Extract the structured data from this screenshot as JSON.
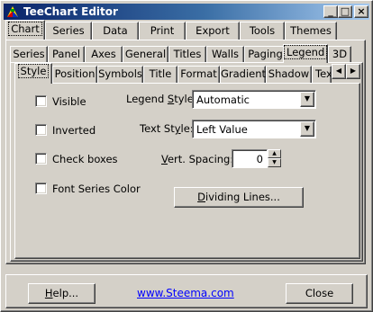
{
  "window": {
    "title": "TeeChart Editor",
    "controls": {
      "minimize": "_",
      "maximize": "□",
      "close": "×"
    }
  },
  "tabs_row1": [
    "Chart",
    "Series",
    "Data",
    "Print",
    "Export",
    "Tools",
    "Themes"
  ],
  "tabs_row1_selected": "Chart",
  "tabs_row2": [
    "Series",
    "Panel",
    "Axes",
    "General",
    "Titles",
    "Walls",
    "Paging",
    "Legend",
    "3D"
  ],
  "tabs_row2_selected": "Legend",
  "tabs_row3": [
    "Style",
    "Position",
    "Symbols",
    "Title",
    "Format",
    "Gradient",
    "Shadow",
    "Tex"
  ],
  "tabs_row3_selected": "Style",
  "tab_scroll": {
    "left": "◀",
    "right": "▶"
  },
  "legend_style_tab": {
    "checkboxes": [
      {
        "label": "Visible",
        "checked": false
      },
      {
        "label": "Inverted",
        "checked": false
      },
      {
        "label": "Check boxes",
        "checked": false
      },
      {
        "label": "Font Series Color",
        "checked": false
      }
    ],
    "legend_style": {
      "label_pre": "Legend ",
      "label_u": "S",
      "label_post": "tyle:",
      "value": "Automatic"
    },
    "text_style": {
      "label_pre": "Text St",
      "label_u": "y",
      "label_post": "le:",
      "value": "Left Value"
    },
    "vert_spacing": {
      "label_pre": "",
      "label_u": "V",
      "label_post": "ert. Spacing:",
      "value": "0"
    },
    "dividing_lines": {
      "label_pre": "",
      "label_u": "D",
      "label_post": "ividing Lines..."
    }
  },
  "footer": {
    "help": {
      "label_pre": "",
      "label_u": "H",
      "label_post": "elp..."
    },
    "link": "www.Steema.com",
    "close": "Close"
  },
  "colors": {
    "face": "#d4d0c8",
    "title_start": "#0a246a",
    "title_end": "#a6caf0",
    "link": "#0000ff"
  }
}
